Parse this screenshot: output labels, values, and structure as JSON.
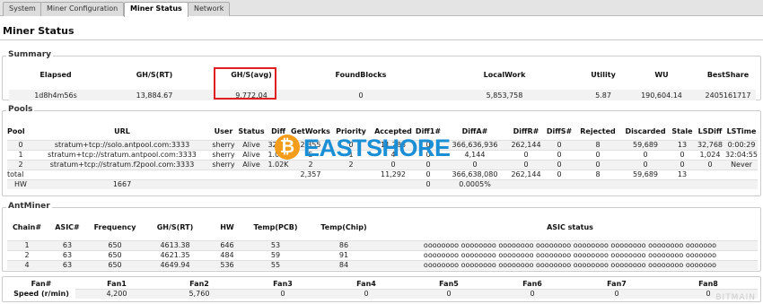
{
  "tabs": [
    {
      "label": "System"
    },
    {
      "label": "Miner Configuration"
    },
    {
      "label": "Miner Status"
    },
    {
      "label": "Network"
    }
  ],
  "page_title": "Miner Status",
  "summary": {
    "legend": "Summary",
    "headers": [
      "Elapsed",
      "GH/S(RT)",
      "GH/S(avg)",
      "FoundBlocks",
      "LocalWork",
      "Utility",
      "WU",
      "BestShare"
    ],
    "values": [
      "1d8h4m56s",
      "13,884.67",
      "9,772.04",
      "0",
      "5,853,758",
      "5.87",
      "190,604.14",
      "2405161717"
    ]
  },
  "pools": {
    "legend": "Pools",
    "headers": [
      "Pool",
      "URL",
      "User",
      "Status",
      "Diff",
      "GetWorks",
      "Priority",
      "Accepted",
      "Diff1#",
      "DiffA#",
      "DiffR#",
      "DiffS#",
      "Rejected",
      "Discarded",
      "Stale",
      "LSDiff",
      "LSTime"
    ],
    "rows": [
      [
        "0",
        "stratum+tcp://solo.antpool.com:3333",
        "sherry",
        "Alive",
        "32.8K",
        "2,355",
        "0",
        "11,288",
        "0",
        "366,636,936",
        "262,144",
        "0",
        "8",
        "59,689",
        "13",
        "32,768",
        "0:00:29"
      ],
      [
        "1",
        "stratum+tcp://stratum.antpool.com:3333",
        "sherry",
        "Alive",
        "1.02K",
        "5",
        "1",
        "4",
        "0",
        "4,144",
        "0",
        "0",
        "0",
        "0",
        "0",
        "1,024",
        "32:04:55"
      ],
      [
        "2",
        "stratum+tcp://stratum.f2pool.com:3333",
        "sherry",
        "Alive",
        "1.02K",
        "2",
        "2",
        "0",
        "0",
        "0",
        "0",
        "0",
        "0",
        "0",
        "0",
        "0",
        "Never"
      ],
      [
        "total",
        "",
        "",
        "",
        "",
        "2,357",
        "",
        "11,292",
        "0",
        "366,638,080",
        "262,144",
        "0",
        "8",
        "59,689",
        "13",
        "",
        ""
      ],
      [
        "HW",
        "1667",
        "",
        "",
        "",
        "",
        "",
        "",
        "0",
        "0.0005%",
        "",
        "",
        "",
        "",
        "",
        "",
        ""
      ]
    ]
  },
  "antminer": {
    "legend": "AntMiner",
    "headers": [
      "Chain#",
      "ASIC#",
      "Frequency",
      "GH/S(RT)",
      "HW",
      "Temp(PCB)",
      "Temp(Chip)",
      "ASIC status"
    ],
    "rows": [
      [
        "1",
        "63",
        "650",
        "4613.38",
        "646",
        "53",
        "86",
        "oooooooo oooooooo oooooooo oooooooo oooooooo oooooooo oooooooo ooooooo"
      ],
      [
        "2",
        "63",
        "650",
        "4621.35",
        "484",
        "59",
        "91",
        "oooooooo oooooooo oooooooo oooooooo oooooooo oooooooo oooooooo ooooooo"
      ],
      [
        "4",
        "63",
        "650",
        "4649.94",
        "536",
        "55",
        "84",
        "oooooooo oooooooo oooooooo oooooooo oooooooo oooooooo oooooooo ooooooo"
      ]
    ]
  },
  "fans": {
    "headers": [
      "Fan#",
      "Fan1",
      "Fan2",
      "Fan3",
      "Fan4",
      "Fan5",
      "Fan6",
      "Fan7",
      "Fan8"
    ],
    "values": [
      "Speed (r/min)",
      "4,200",
      "5,760",
      "0",
      "0",
      "0",
      "0",
      "0",
      "0"
    ]
  },
  "watermark": {
    "symbol": "₿",
    "text": "EASTSHORE"
  },
  "footer_brand": "BITMAIN",
  "colors": {
    "highlight": "#e02020",
    "watermark_blue": "#1a8fd6",
    "watermark_orange": "#f49d1a"
  }
}
